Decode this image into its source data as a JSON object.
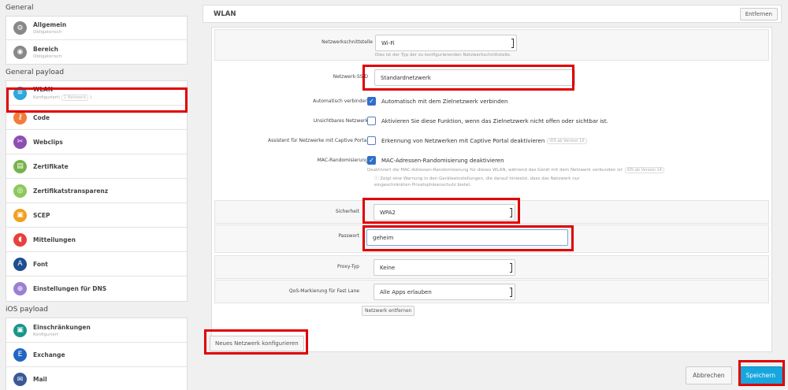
{
  "sidebar": {
    "general_title": "General",
    "general_items": [
      {
        "name": "Allgemein",
        "sub": "Obligatorisch",
        "color": "#888888",
        "icon": "gear-icon",
        "glyph": "⚙"
      },
      {
        "name": "Bereich",
        "sub": "Obligatorisch",
        "color": "#888888",
        "icon": "scope-icon",
        "glyph": "◉"
      }
    ],
    "payload_title": "General payload",
    "payload_items": [
      {
        "name": "WLAN",
        "sub": "Konfiguriert",
        "badge": "1 Netzwerk",
        "color": "#2fa6dd",
        "icon": "wifi-icon",
        "glyph": "≋",
        "active": true
      },
      {
        "name": "Code",
        "color": "#ef7d3c",
        "icon": "key-icon",
        "glyph": "⚷"
      },
      {
        "name": "Webclips",
        "color": "#8e4fb5",
        "icon": "webclip-icon",
        "glyph": "✂"
      },
      {
        "name": "Zertifikate",
        "color": "#77b24a",
        "icon": "certificate-icon",
        "glyph": "▤"
      },
      {
        "name": "Zertifikatstransparenz",
        "color": "#8cc85a",
        "icon": "certificate-transparency-icon",
        "glyph": "◎"
      },
      {
        "name": "SCEP",
        "color": "#f0a020",
        "icon": "lock-icon",
        "glyph": "▣"
      },
      {
        "name": "Mitteilungen",
        "color": "#e8413c",
        "icon": "notification-icon",
        "glyph": "◖"
      },
      {
        "name": "Font",
        "color": "#1d4f91",
        "icon": "font-icon",
        "glyph": "A"
      },
      {
        "name": "Einstellungen für DNS",
        "color": "#9b7fd4",
        "icon": "globe-icon",
        "glyph": "⊕"
      }
    ],
    "ios_title": "iOS payload",
    "ios_items": [
      {
        "name": "Einschränkungen",
        "sub": "Konfiguriert",
        "color": "#17968a",
        "icon": "restriction-lock-icon",
        "glyph": "▣"
      },
      {
        "name": "Exchange",
        "color": "#2266c4",
        "icon": "exchange-icon",
        "glyph": "E"
      },
      {
        "name": "Mail",
        "color": "#3b5998",
        "icon": "mail-icon",
        "glyph": "✉"
      }
    ]
  },
  "header": {
    "title": "WLAN",
    "remove_label": "Entfernen"
  },
  "form": {
    "interface": {
      "label": "Netzwerkschnittstelle",
      "value": "Wi-Fi",
      "hint": "Dies ist der Typ der zu konfigurierenden Netzwerkschnittstelle."
    },
    "ssid": {
      "label": "Netzwerk-SSID",
      "value": "Standardnetzwerk"
    },
    "auto_join": {
      "label": "Automatisch verbinden",
      "text": "Automatisch mit dem Zielnetzwerk verbinden"
    },
    "hidden": {
      "label": "Unsichtbares Netzwerk",
      "text": "Aktivieren Sie diese Funktion, wenn das Zielnetzwerk nicht offen oder sichtbar ist."
    },
    "captive": {
      "label": "Assistent für Netzwerke mit Captive Portal",
      "text": "Erkennung von Netzwerken mit Captive Portal deaktivieren",
      "version": "iOS ab Version 10"
    },
    "mac": {
      "label": "MAC-Randomisierung",
      "text": "MAC-Adressen-Randomisierung deaktivieren",
      "hint": "Deaktiviert die MAC-Adressen-Randomisierung für dieses WLAN, während das Gerät mit dem Netzwerk verbunden ist",
      "version": "iOS ab Version 14",
      "hint2": "ⓘ Zeigt eine Warnung in den Geräteeinstellungen, die darauf hinweist, dass das Netzwerk nur",
      "hint3": "eingeschränkten Privatsphärenschutz bietet."
    },
    "security": {
      "label": "Sicherheit",
      "value": "WPA2"
    },
    "password": {
      "label": "Passwort",
      "value": "geheim"
    },
    "proxy": {
      "label": "Proxy-Typ",
      "value": "Keine"
    },
    "qos": {
      "label": "QoS-Markierung für Fast Lane",
      "value": "Alle Apps erlauben"
    },
    "remove_network": "Netzwerk entfernen",
    "new_network": "Neues Netzwerk konfigurieren"
  },
  "footer": {
    "cancel": "Abbrechen",
    "save": "Speichern"
  }
}
